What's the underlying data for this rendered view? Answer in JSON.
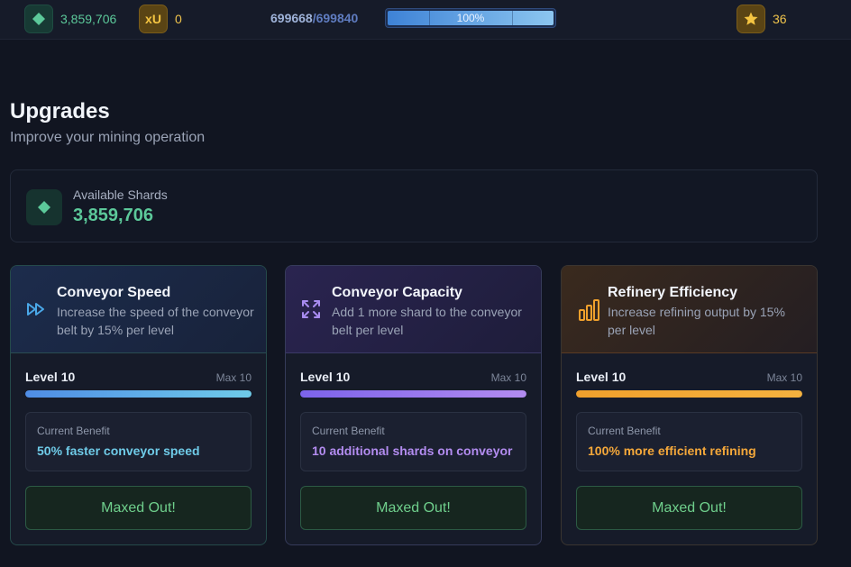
{
  "topbar": {
    "shards": "3,859,706",
    "xu_icon": "xU",
    "xu_count": "0",
    "xp_current": "699668",
    "xp_separator": "/",
    "xp_max": "699840",
    "xp_percent_label": "100%",
    "xp_progress": 1.0,
    "stars": "36"
  },
  "header": {
    "title": "Upgrades",
    "subtitle": "Improve your mining operation"
  },
  "shards_panel": {
    "label": "Available Shards",
    "value": "3,859,706"
  },
  "colors": {
    "shard_green": "#5cc99a",
    "speed_blue": "#6fcbe8",
    "capacity_purple": "#b38cf0",
    "refinery_orange": "#f5a83a",
    "maxed_green": "#6fcf8c"
  },
  "cards": [
    {
      "icon": "fast-forward-icon",
      "title": "Conveyor Speed",
      "description": "Increase the speed of the conveyor belt by 15% per level",
      "level_label": "Level 10",
      "max_label": "Max 10",
      "progress": 1.0,
      "benefit_label": "Current Benefit",
      "benefit_value": "50% faster conveyor speed",
      "button_label": "Maxed Out!"
    },
    {
      "icon": "expand-icon",
      "title": "Conveyor Capacity",
      "description": "Add 1 more shard to the conveyor belt per level",
      "level_label": "Level 10",
      "max_label": "Max 10",
      "progress": 1.0,
      "benefit_label": "Current Benefit",
      "benefit_value": "10 additional shards on conveyor",
      "button_label": "Maxed Out!"
    },
    {
      "icon": "bar-chart-icon",
      "title": "Refinery Efficiency",
      "description": "Increase refining output by 15% per level",
      "level_label": "Level 10",
      "max_label": "Max 10",
      "progress": 1.0,
      "benefit_label": "Current Benefit",
      "benefit_value": "100% more efficient refining",
      "button_label": "Maxed Out!"
    }
  ]
}
